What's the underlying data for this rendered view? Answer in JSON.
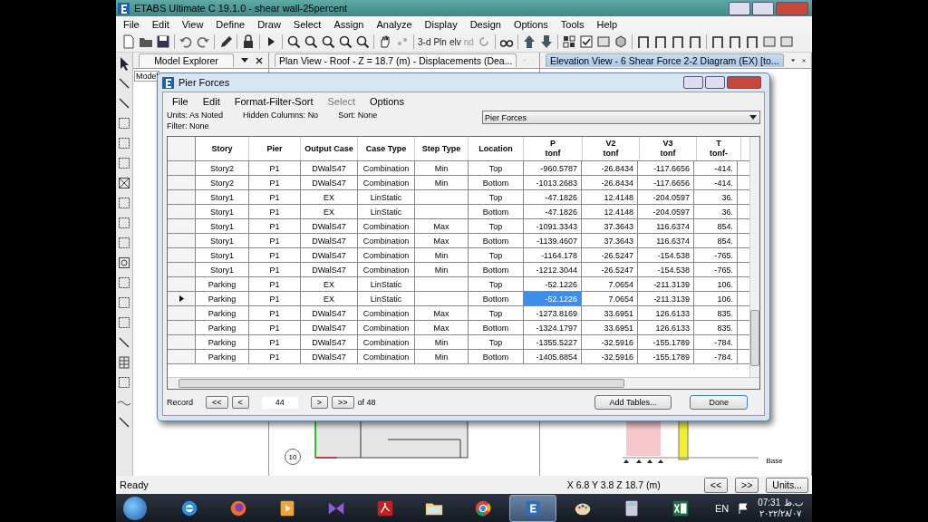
{
  "window": {
    "title": "ETABS Ultimate C 19.1.0 - shear wall-25percent"
  },
  "menu": [
    "File",
    "Edit",
    "View",
    "Define",
    "Draw",
    "Select",
    "Assign",
    "Analyze",
    "Display",
    "Design",
    "Options",
    "Tools",
    "Help"
  ],
  "toolbar": [
    {
      "kind": "page"
    },
    {
      "kind": "open"
    },
    {
      "kind": "save"
    },
    {
      "kind": "sep"
    },
    {
      "kind": "undo"
    },
    {
      "kind": "redo"
    },
    {
      "kind": "sep"
    },
    {
      "kind": "pencil"
    },
    {
      "kind": "sep"
    },
    {
      "kind": "lock"
    },
    {
      "kind": "sep"
    },
    {
      "kind": "play"
    },
    {
      "kind": "sep"
    },
    {
      "kind": "zoom"
    },
    {
      "kind": "zoom"
    },
    {
      "kind": "zoom"
    },
    {
      "kind": "zoom"
    },
    {
      "kind": "zoom"
    },
    {
      "kind": "sep"
    },
    {
      "kind": "hand"
    },
    {
      "kind": "dots"
    },
    {
      "kind": "sep"
    },
    {
      "kind": "text",
      "label": "3-d",
      "disabled": false
    },
    {
      "kind": "text",
      "label": "Pln",
      "disabled": false
    },
    {
      "kind": "text",
      "label": "elv",
      "disabled": false
    },
    {
      "kind": "text",
      "label": "nd",
      "disabled": true
    },
    {
      "kind": "rotate"
    },
    {
      "kind": "sep"
    },
    {
      "kind": "glasses"
    },
    {
      "kind": "sep"
    },
    {
      "kind": "up"
    },
    {
      "kind": "down"
    },
    {
      "kind": "sep"
    },
    {
      "kind": "grid"
    },
    {
      "kind": "check"
    },
    {
      "kind": "box"
    },
    {
      "kind": "cube"
    },
    {
      "kind": "sep"
    },
    {
      "kind": "frame"
    },
    {
      "kind": "frame"
    },
    {
      "kind": "frame"
    },
    {
      "kind": "frame"
    },
    {
      "kind": "sep"
    },
    {
      "kind": "frame"
    },
    {
      "kind": "frame"
    },
    {
      "kind": "frame"
    },
    {
      "kind": "box"
    },
    {
      "kind": "box"
    }
  ],
  "panels": [
    {
      "title": "Model Explorer",
      "selected": false,
      "subtab": "Model"
    },
    {
      "title": "Plan View - Roof - Z = 18.7 (m)  - Displacements (Dea...",
      "selected": false,
      "marker": "10"
    },
    {
      "title": "Elevation View - 6   Shear Force 2-2 Diagram   (EX)  [to...",
      "selected": true,
      "marker": "Base"
    }
  ],
  "dialog": {
    "title": "Pier Forces",
    "menu": [
      {
        "label": "File",
        "disabled": false
      },
      {
        "label": "Edit",
        "disabled": false
      },
      {
        "label": "Format-Filter-Sort",
        "disabled": false
      },
      {
        "label": "Select",
        "disabled": true
      },
      {
        "label": "Options",
        "disabled": false
      }
    ],
    "info": [
      {
        "label": "Units:",
        "value": "As Noted"
      },
      {
        "label": "Hidden Columns:",
        "value": "No"
      },
      {
        "label": "Sort:",
        "value": "None"
      },
      {
        "label": "Filter:",
        "value": "None"
      }
    ],
    "table_select": "Pier Forces",
    "columns": [
      {
        "title": "Story"
      },
      {
        "title": "Pier"
      },
      {
        "title": "Output Case"
      },
      {
        "title": "Case Type"
      },
      {
        "title": "Step Type"
      },
      {
        "title": "Location"
      },
      {
        "title": "P",
        "unit": "tonf"
      },
      {
        "title": "V2",
        "unit": "tonf"
      },
      {
        "title": "V3",
        "unit": "tonf"
      },
      {
        "title": "T",
        "unit": "tonf-"
      }
    ],
    "rows": [
      {
        "current": false,
        "p_selected": false,
        "cells": [
          "Story2",
          "P1",
          "DWalS47",
          "Combination",
          "Min",
          "Top",
          "-960.5787",
          "-26.8434",
          "-117.6656",
          "-414."
        ]
      },
      {
        "current": false,
        "p_selected": false,
        "cells": [
          "Story2",
          "P1",
          "DWalS47",
          "Combination",
          "Min",
          "Bottom",
          "-1013.2683",
          "-26.8434",
          "-117.6656",
          "-414."
        ]
      },
      {
        "current": false,
        "p_selected": false,
        "cells": [
          "Story1",
          "P1",
          "EX",
          "LinStatic",
          null,
          "Top",
          "-47.1826",
          "12.4148",
          "-204.0597",
          "36."
        ]
      },
      {
        "current": false,
        "p_selected": false,
        "cells": [
          "Story1",
          "P1",
          "EX",
          "LinStatic",
          null,
          "Bottom",
          "-47.1826",
          "12.4148",
          "-204.0597",
          "36."
        ]
      },
      {
        "current": false,
        "p_selected": false,
        "cells": [
          "Story1",
          "P1",
          "DWalS47",
          "Combination",
          "Max",
          "Top",
          "-1091.3343",
          "37.3643",
          "116.6374",
          "854."
        ]
      },
      {
        "current": false,
        "p_selected": false,
        "cells": [
          "Story1",
          "P1",
          "DWalS47",
          "Combination",
          "Max",
          "Bottom",
          "-1139.4607",
          "37.3643",
          "116.6374",
          "854."
        ]
      },
      {
        "current": false,
        "p_selected": false,
        "cells": [
          "Story1",
          "P1",
          "DWalS47",
          "Combination",
          "Min",
          "Top",
          "-1164.178",
          "-26.5247",
          "-154.538",
          "-765."
        ]
      },
      {
        "current": false,
        "p_selected": false,
        "cells": [
          "Story1",
          "P1",
          "DWalS47",
          "Combination",
          "Min",
          "Bottom",
          "-1212.3044",
          "-26.5247",
          "-154.538",
          "-765."
        ]
      },
      {
        "current": false,
        "p_selected": false,
        "cells": [
          "Parking",
          "P1",
          "EX",
          "LinStatic",
          null,
          "Top",
          "-52.1226",
          "7.0654",
          "-211.3139",
          "106."
        ]
      },
      {
        "current": true,
        "p_selected": true,
        "cells": [
          "Parking",
          "P1",
          "EX",
          "LinStatic",
          null,
          "Bottom",
          "-52.1226",
          "7.0654",
          "-211.3139",
          "106."
        ]
      },
      {
        "current": false,
        "p_selected": false,
        "cells": [
          "Parking",
          "P1",
          "DWalS47",
          "Combination",
          "Max",
          "Top",
          "-1273.8169",
          "33.6951",
          "126.6133",
          "835."
        ]
      },
      {
        "current": false,
        "p_selected": false,
        "cells": [
          "Parking",
          "P1",
          "DWalS47",
          "Combination",
          "Max",
          "Bottom",
          "-1324.1797",
          "33.6951",
          "126.6133",
          "835."
        ]
      },
      {
        "current": false,
        "p_selected": false,
        "cells": [
          "Parking",
          "P1",
          "DWalS47",
          "Combination",
          "Min",
          "Top",
          "-1355.5227",
          "-32.5916",
          "-155.1789",
          "-784."
        ]
      },
      {
        "current": false,
        "p_selected": false,
        "cells": [
          "Parking",
          "P1",
          "DWalS47",
          "Combination",
          "Min",
          "Bottom",
          "-1405.8854",
          "-32.5916",
          "-155.1789",
          "-784."
        ]
      }
    ],
    "record": {
      "label": "Record",
      "first": "<<",
      "prev": "<",
      "value": "44",
      "next": ">",
      "last": ">>",
      "of": "of 48"
    },
    "buttons": [
      "Add Tables...",
      "Done"
    ]
  },
  "status_bar": {
    "text": "Ready",
    "coords": "X 6.8  Y 3.8  Z 18.7 (m)",
    "buttons": [
      "<<",
      ">>",
      "Units..."
    ]
  },
  "taskbar": {
    "apps": [
      {
        "kind": "browser-e",
        "selected": false
      },
      {
        "kind": "fox",
        "selected": false
      },
      {
        "kind": "player",
        "selected": false
      },
      {
        "kind": "bow",
        "selected": false
      },
      {
        "kind": "pdf",
        "selected": false
      },
      {
        "kind": "folder",
        "selected": false
      },
      {
        "kind": "chrome",
        "selected": false
      },
      {
        "kind": "etabs",
        "selected": true
      },
      {
        "kind": "palette",
        "selected": false
      },
      {
        "kind": "calc",
        "selected": false
      },
      {
        "kind": "excel",
        "selected": false
      }
    ],
    "lang": "EN",
    "time": "07:31",
    "ampm": "ب.ظ",
    "date": "۲۰۲۲/۲۸/۰۷"
  }
}
